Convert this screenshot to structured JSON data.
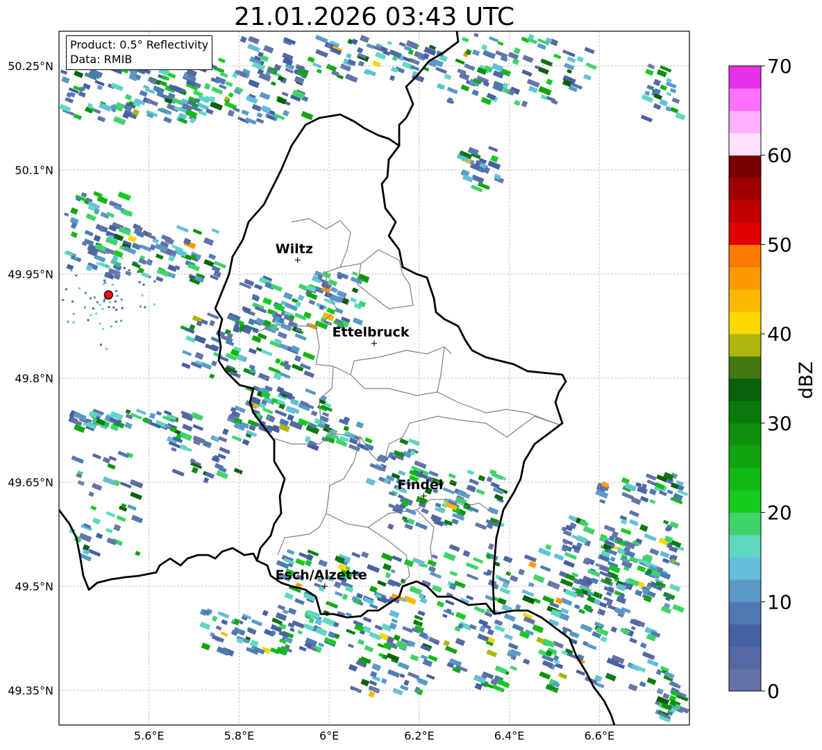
{
  "title": "21.01.2026 03:43 UTC",
  "info_box": {
    "product": "Product: 0.5° Reflectivity",
    "source": "Data: RMIB"
  },
  "map": {
    "lat_ticks": [
      {
        "value": 50.25,
        "label": "50.25°N"
      },
      {
        "value": 50.1,
        "label": "50.1°N"
      },
      {
        "value": 49.95,
        "label": "49.95°N"
      },
      {
        "value": 49.8,
        "label": "49.8°N"
      },
      {
        "value": 49.65,
        "label": "49.65°N"
      },
      {
        "value": 49.5,
        "label": "49.5°N"
      },
      {
        "value": 49.35,
        "label": "49.35°N"
      }
    ],
    "lon_ticks": [
      {
        "value": 5.6,
        "label": "5.6°E"
      },
      {
        "value": 5.8,
        "label": "5.8°E"
      },
      {
        "value": 6.0,
        "label": "6°E"
      },
      {
        "value": 6.2,
        "label": "6.2°E"
      },
      {
        "value": 6.4,
        "label": "6.4°E"
      },
      {
        "value": 6.6,
        "label": "6.6°E"
      }
    ],
    "lon_range": [
      5.4,
      6.8
    ],
    "lat_range": [
      49.3,
      50.3
    ],
    "gridlines": true,
    "radar_site": {
      "lon": 5.51,
      "lat": 49.92,
      "color": "#ee1111"
    },
    "cities": [
      {
        "name": "Wiltz",
        "lon": 5.93,
        "lat": 49.97
      },
      {
        "name": "Ettelbruck",
        "lon": 6.1,
        "lat": 49.85
      },
      {
        "name": "Findel",
        "lon": 6.21,
        "lat": 49.63
      },
      {
        "name": "Esch/Alzette",
        "lon": 5.99,
        "lat": 49.5
      }
    ]
  },
  "colorbar": {
    "label": "dBZ",
    "min": 0,
    "max": 70,
    "tick_labels": [
      "0",
      "10",
      "20",
      "30",
      "40",
      "50",
      "60",
      "70"
    ],
    "colors": [
      "#6474a8",
      "#5469a3",
      "#4660a3",
      "#4e7ab1",
      "#5a99c6",
      "#64bfd9",
      "#5fd8c3",
      "#3fd46a",
      "#14cc1e",
      "#12ba14",
      "#10a511",
      "#0d900e",
      "#0b7a0c",
      "#086109",
      "#457810",
      "#adb40a",
      "#fdd700",
      "#fdb700",
      "#fd9900",
      "#fd7a00",
      "#e00000",
      "#c00000",
      "#a00000",
      "#780000",
      "#ffe0ff",
      "#ffb0ff",
      "#fe70fe",
      "#e730e7"
    ]
  }
}
